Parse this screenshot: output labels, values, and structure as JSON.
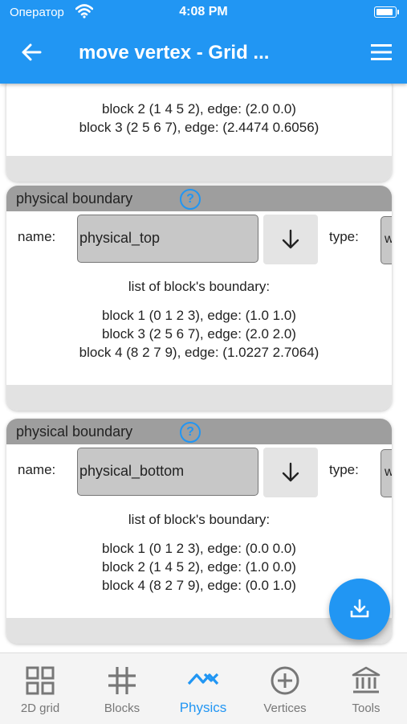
{
  "status_bar": {
    "carrier": "Оператор",
    "time": "4:08 PM"
  },
  "app_bar": {
    "title": "move vertex - Grid ..."
  },
  "top_card": {
    "boundary_lines": [
      "block 2 (1 4 5 2), edge: (2.0 0.0)",
      "block 3 (2 5 6 7), edge: (2.4474 0.6056)"
    ]
  },
  "cards": [
    {
      "header": "physical boundary",
      "help_glyph": "?",
      "name_label": "name:",
      "name_value": "physical_top",
      "type_label": "type:",
      "type_value": "w",
      "list_title": "list of block's boundary:",
      "boundary_lines": [
        "block 1 (0 1 2 3), edge: (1.0 1.0)",
        "block 3 (2 5 6 7), edge: (2.0 2.0)",
        "block 4 (8 2 7 9), edge: (1.0227 2.7064)"
      ]
    },
    {
      "header": "physical boundary",
      "help_glyph": "?",
      "name_label": "name:",
      "name_value": "physical_bottom",
      "type_label": "type:",
      "type_value": "w",
      "list_title": "list of block's boundary:",
      "boundary_lines": [
        "block 1 (0 1 2 3), edge: (0.0 0.0)",
        "block 2 (1 4 5 2), edge: (1.0 0.0)",
        "block 4 (8 2 7 9), edge: (0.0 1.0)"
      ]
    }
  ],
  "bottom_nav": {
    "items": [
      {
        "label": "2D grid",
        "icon": "grid-view-icon"
      },
      {
        "label": "Blocks",
        "icon": "hashtag-icon"
      },
      {
        "label": "Physics",
        "icon": "physics-wave-icon",
        "active": true
      },
      {
        "label": "Vertices",
        "icon": "add-circle-icon"
      },
      {
        "label": "Tools",
        "icon": "bank-icon"
      }
    ]
  },
  "colors": {
    "primary": "#2196f3",
    "header_gray": "#9e9e9e",
    "input_gray": "#c7c7c7"
  }
}
